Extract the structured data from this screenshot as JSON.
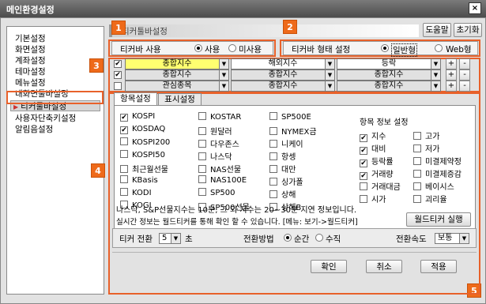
{
  "window": {
    "title": "메인환경설정",
    "close_label": "×"
  },
  "sidebar": {
    "items": [
      {
        "label": "기본설정",
        "selected": false
      },
      {
        "label": "화면설정",
        "selected": false
      },
      {
        "label": "계좌설정",
        "selected": false
      },
      {
        "label": "테마설정",
        "selected": false
      },
      {
        "label": "메뉴설정",
        "selected": false
      },
      {
        "label": "내화면툴바설정",
        "selected": false
      },
      {
        "label": "티커툴바설정",
        "selected": true
      },
      {
        "label": "사용자단축키설정",
        "selected": false
      },
      {
        "label": "알림음설정",
        "selected": false
      }
    ]
  },
  "header": {
    "title": "티커툴바설정",
    "help_label": "도움말",
    "reset_label": "초기화"
  },
  "badges": [
    "1",
    "2",
    "3",
    "4",
    "5"
  ],
  "ticker_use": {
    "label": "티커바 사용",
    "on_label": "사용",
    "off_label": "미사용",
    "selected": "사용"
  },
  "ticker_type": {
    "label": "티커바 형태 설정",
    "options": [
      "일반형",
      "Web형"
    ],
    "selected": "일반형"
  },
  "rows": [
    {
      "checked": true,
      "c1": "종합지수",
      "c2": "해외지수",
      "c3": "등락"
    },
    {
      "checked": true,
      "c1": "종합지수",
      "c2": "종합지수",
      "c3": "종합지수"
    },
    {
      "checked": false,
      "c1": "관심종목",
      "c2": "종합지수",
      "c3": "종합지수"
    }
  ],
  "row_buttons": {
    "plus": "+",
    "minus": "-"
  },
  "tabs": [
    {
      "label": "항목설정",
      "active": true
    },
    {
      "label": "표시설정",
      "active": false
    }
  ],
  "items": [
    [
      {
        "label": "KOSPI",
        "checked": true
      },
      {
        "label": "KOSDAQ",
        "checked": true
      },
      {
        "label": "KOSPI200",
        "checked": false
      },
      {
        "label": "KOSPI50",
        "checked": false
      },
      {
        "label": "최근월선물",
        "checked": false
      },
      {
        "label": "KBasis",
        "checked": false
      },
      {
        "label": "KODI",
        "checked": false
      },
      {
        "label": "KOGI",
        "checked": false
      }
    ],
    [
      {
        "label": "KOSTAR",
        "checked": false
      },
      {
        "label": "원달러",
        "checked": false
      },
      {
        "label": "다우존스",
        "checked": false
      },
      {
        "label": "나스닥",
        "checked": false
      },
      {
        "label": "NAS선물",
        "checked": false
      },
      {
        "label": "NAS100E",
        "checked": false
      },
      {
        "label": "SP500",
        "checked": false
      },
      {
        "label": "SP500선물",
        "checked": false
      }
    ],
    [
      {
        "label": "SP500E",
        "checked": false
      },
      {
        "label": "NYMEX금",
        "checked": false
      },
      {
        "label": "니케이",
        "checked": false
      },
      {
        "label": "항셍",
        "checked": false
      },
      {
        "label": "대만",
        "checked": false
      },
      {
        "label": "싱가폴",
        "checked": false
      },
      {
        "label": "상해",
        "checked": false
      },
      {
        "label": "상해B",
        "checked": false
      }
    ]
  ],
  "info": {
    "title": "항목 정보 설정",
    "col1": [
      {
        "label": "지수",
        "checked": true
      },
      {
        "label": "대비",
        "checked": true
      },
      {
        "label": "등락률",
        "checked": true
      },
      {
        "label": "거래량",
        "checked": true
      },
      {
        "label": "거래대금",
        "checked": false
      },
      {
        "label": "시가",
        "checked": false
      }
    ],
    "col2": [
      {
        "label": "고가",
        "checked": false
      },
      {
        "label": "저가",
        "checked": false
      },
      {
        "label": "미결제약정",
        "checked": false
      },
      {
        "label": "미결제증감",
        "checked": false
      },
      {
        "label": "베이시스",
        "checked": false
      },
      {
        "label": "괴리율",
        "checked": false
      }
    ]
  },
  "notes": {
    "line1": "나스닥, S&P선물지수는 10분, 그 외 지수는 20~30분 지연 정보입니다.",
    "line2": "실시간 정보는 월드티커를 통해 확인 할 수 있습니다. [메뉴: 보기->월드티커]",
    "world_ticker_label": "월드티커 실행"
  },
  "bottom": {
    "switch_label": "티커 전환",
    "switch_value": "5",
    "sec_label": "초",
    "method_label": "전환방법",
    "method_options": [
      "순간",
      "수직"
    ],
    "method_selected": "순간",
    "speed_label": "전환속도",
    "speed_value": "보통"
  },
  "footer": {
    "ok": "확인",
    "cancel": "취소",
    "apply": "적용"
  },
  "colors": {
    "badge": "#ee6a1a",
    "highlight": "#ffff70"
  }
}
